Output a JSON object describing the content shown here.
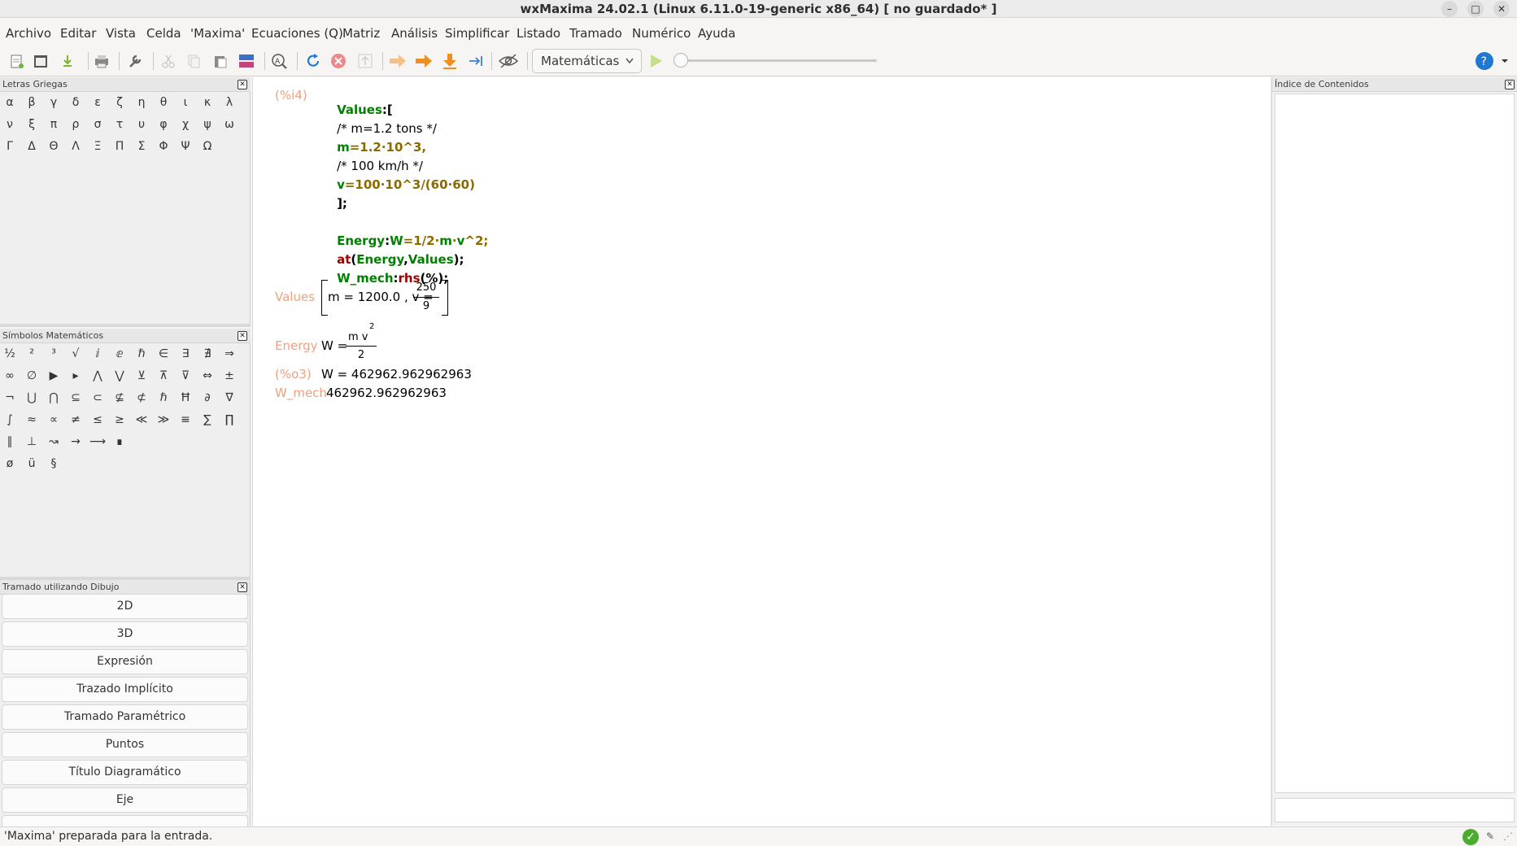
{
  "window": {
    "title": "wxMaxima 24.02.1 (Linux 6.11.0-19-generic x86_64) [ no guardado* ]",
    "minimize": "–",
    "maximize": "□",
    "close": "✕"
  },
  "menubar": [
    "Archivo",
    "Editar",
    "Vista",
    "Celda",
    "'Maxima'",
    "Ecuaciones (Q)",
    "Matriz",
    "Análisis",
    "Simplificar",
    "Listado",
    "Tramado",
    "Numérico",
    "Ayuda"
  ],
  "toolbar": {
    "mode": "Matemáticas",
    "icons": [
      "new-icon",
      "open-icon",
      "save-icon",
      "print-icon",
      "settings-icon",
      "cut-icon",
      "copy-icon",
      "paste-icon",
      "select-all-icon",
      "find-icon",
      "refresh-icon",
      "stop-icon",
      "jump-up-icon",
      "evaluate-icon",
      "evaluate-all-icon",
      "evaluate-to-end-icon",
      "jump-end-icon",
      "hide-code-icon",
      "play-icon",
      "help-icon"
    ],
    "slider_position": 0
  },
  "greek_panel": {
    "title": "Letras Griegas",
    "rows": [
      [
        "α",
        "β",
        "γ",
        "δ",
        "ε",
        "ζ",
        "η",
        "θ",
        "ι",
        "κ",
        "λ"
      ],
      [
        "ν",
        "ξ",
        "π",
        "ρ",
        "σ",
        "τ",
        "υ",
        "φ",
        "χ",
        "ψ",
        "ω"
      ],
      [
        "Γ",
        "Δ",
        "Θ",
        "Λ",
        "Ξ",
        "Π",
        "Σ",
        "Φ",
        "Ψ",
        "Ω"
      ]
    ]
  },
  "math_panel": {
    "title": "Símbolos Matemáticos",
    "rows": [
      [
        "½",
        "²",
        "³",
        "√",
        "ⅈ",
        "ⅇ",
        "ℏ",
        "∈",
        "∃",
        "∄",
        "⇒"
      ],
      [
        "∞",
        "∅",
        "▶",
        "▸",
        "⋀",
        "⋁",
        "⊻",
        "⊼",
        "⊽",
        "⇔",
        "±"
      ],
      [
        "¬",
        "⋃",
        "⋂",
        "⊆",
        "⊂",
        "⊈",
        "⊄",
        "ℏ",
        "Ħ",
        "∂",
        "∇"
      ],
      [
        "∫",
        "≈",
        "∝",
        "≠",
        "≤",
        "≥",
        "≪",
        "≫",
        "≡",
        "∑",
        "∏"
      ],
      [
        "∥",
        "⊥",
        "↝",
        "→",
        "⟶",
        "∎"
      ],
      [
        "ø",
        "ü",
        "§"
      ]
    ]
  },
  "plot_panel": {
    "title": "Tramado utilizando Dibujo",
    "buttons": [
      "2D",
      "3D",
      "Expresión",
      "Trazado Implícito",
      "Tramado Paramétrico",
      "Puntos",
      "Título Diagramático",
      "Eje"
    ]
  },
  "worksheet": {
    "input_label": "(%i4)",
    "code": [
      [
        [
          "Values",
          "g"
        ],
        [
          ":[",
          "k"
        ]
      ],
      [
        [
          "/* m=1.2 tons */",
          "c"
        ]
      ],
      [
        [
          "m",
          "g"
        ],
        [
          "=1.2·10^3,",
          "n"
        ]
      ],
      [
        [
          "/* 100 km/h */",
          "c"
        ]
      ],
      [
        [
          "v",
          "g"
        ],
        [
          "=100·10^3/(60·60)",
          "n"
        ]
      ],
      [
        [
          "];",
          "k"
        ]
      ],
      [],
      [
        [
          "Energy",
          "g"
        ],
        [
          ":",
          "k"
        ],
        [
          "W",
          "g"
        ],
        [
          "=1/2·",
          "n"
        ],
        [
          "m",
          "g"
        ],
        [
          "·",
          "n"
        ],
        [
          "v",
          "g"
        ],
        [
          "^2;",
          "n"
        ]
      ],
      [
        [
          "at",
          "r"
        ],
        [
          "(",
          "k"
        ],
        [
          "Energy",
          "g"
        ],
        [
          ",",
          "k"
        ],
        [
          "Values",
          "g"
        ],
        [
          ");",
          "k"
        ]
      ],
      [
        [
          "W_mech",
          "g"
        ],
        [
          ":",
          "k"
        ],
        [
          "rhs",
          "r"
        ],
        [
          "(%);",
          "k"
        ]
      ]
    ],
    "outputs": {
      "values_label": "Values",
      "values_m": "m = 1200.0 , v =",
      "values_num": "250",
      "values_den": "9",
      "energy_label": "Energy",
      "energy_lhs": "W =",
      "energy_num": "m v",
      "energy_exp": "2",
      "energy_den": "2",
      "o3_label": "(%o3)",
      "o3_value": "W = 462962.962962963",
      "wmech_label": "W_mech",
      "wmech_value": "462962.962962963"
    }
  },
  "toc_panel": {
    "title": "Índice de Contenidos"
  },
  "status": {
    "text": "'Maxima' preparada para la entrada."
  },
  "colors": {
    "variable": "#008000",
    "function": "#a00000",
    "number": "#8a6a00",
    "label": "#f0a080",
    "accent": "#1f78d1"
  }
}
